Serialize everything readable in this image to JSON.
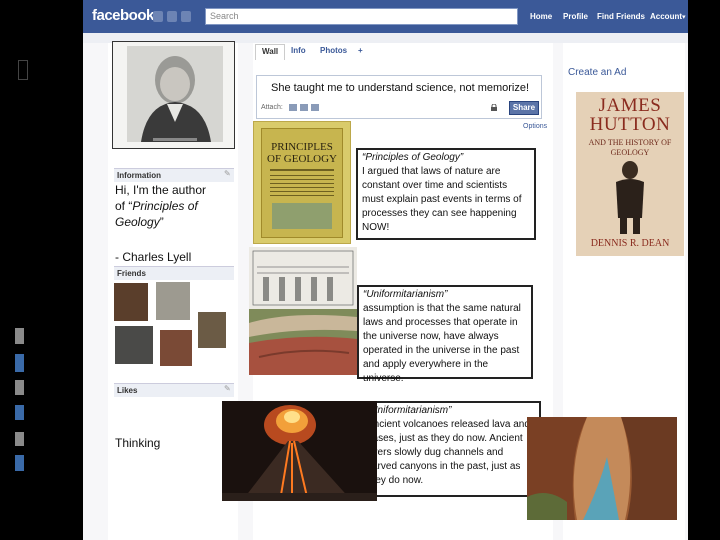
{
  "topbar": {
    "logo": "facebook",
    "search_placeholder": "Search",
    "nav": [
      "Home",
      "Profile",
      "Find Friends",
      "Account"
    ]
  },
  "tabs": [
    "Wall",
    "Info",
    "Photos",
    "+"
  ],
  "status": {
    "text": "She taught me to understand science, not memorize!",
    "attach_label": "Attach:",
    "share_label": "Share",
    "filters_label": "Options"
  },
  "left": {
    "info_heading": "Information",
    "intro_line1": "Hi, I'm the author",
    "intro_line2": "of “",
    "intro_book": "Principles of Geology",
    "intro_close": "”",
    "signature": "- Charles Lyell",
    "friends_heading": "Friends",
    "likes_heading": "Likes",
    "thinking": "Thinking"
  },
  "posts": [
    {
      "title": "“Principles of Geology”",
      "body": "I argued that laws of nature are constant over time and scientists must explain past events in terms of processes they can see happening NOW!"
    },
    {
      "title": "“Uniformitarianism”",
      "body": "assumption is that the same natural laws and processes that operate in the universe now, have always operated in the universe in the past and apply everywhere in the universe."
    },
    {
      "title": "“Uniformitarianism”",
      "body": "Ancient volcanoes released lava and gases, just as they do now. Ancient rivers slowly dug channels and carved canyons in the past, just as they do now."
    }
  ],
  "right": {
    "create_ad": "Create an Ad",
    "book_author": "JAMES HUTTON",
    "book_subtitle": "AND THE HISTORY OF GEOLOGY",
    "book_writer": "DENNIS R. DEAN"
  },
  "book_cover": {
    "title": "PRINCIPLES OF GEOLOGY"
  },
  "colors": {
    "facebook_blue": "#3b5998",
    "panel_border": "#222222",
    "stripe_gray": "#8a8a8a",
    "stripe_blue": "#3a6aa8"
  }
}
